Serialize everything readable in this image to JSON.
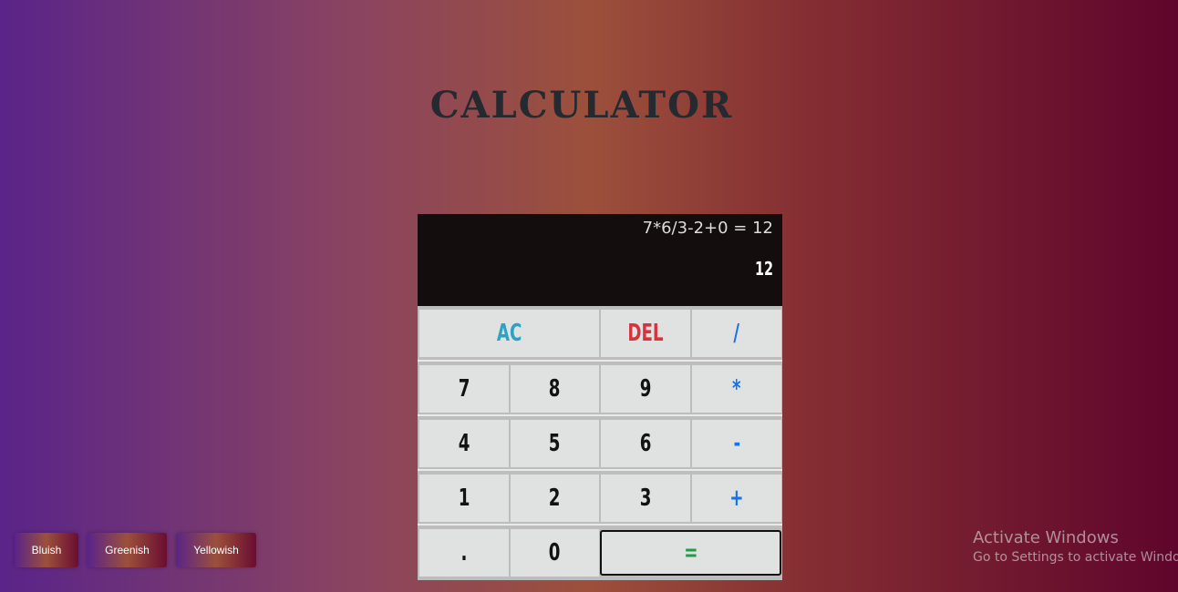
{
  "title": "CALCULATOR",
  "display": {
    "expression": "7*6/3-2+0 = 12",
    "result": "12"
  },
  "keys": {
    "ac": "AC",
    "del": "DEL",
    "divide": "/",
    "seven": "7",
    "eight": "8",
    "nine": "9",
    "multiply": "*",
    "four": "4",
    "five": "5",
    "six": "6",
    "subtract": "-",
    "one": "1",
    "two": "2",
    "three": "3",
    "add": "+",
    "decimal": ".",
    "zero": "0",
    "equals": "="
  },
  "themes": [
    "Bluish",
    "Greenish",
    "Yellowish"
  ],
  "watermark": {
    "line1": "Activate Windows",
    "line2": "Go to Settings to activate Windows."
  },
  "colors": {
    "operator": "#1572e8",
    "ac": "#2aa3c4",
    "del": "#d8323f",
    "equals": "#219a4a",
    "display_bg": "#140d0d",
    "key_bg": "#e0e1e1"
  }
}
